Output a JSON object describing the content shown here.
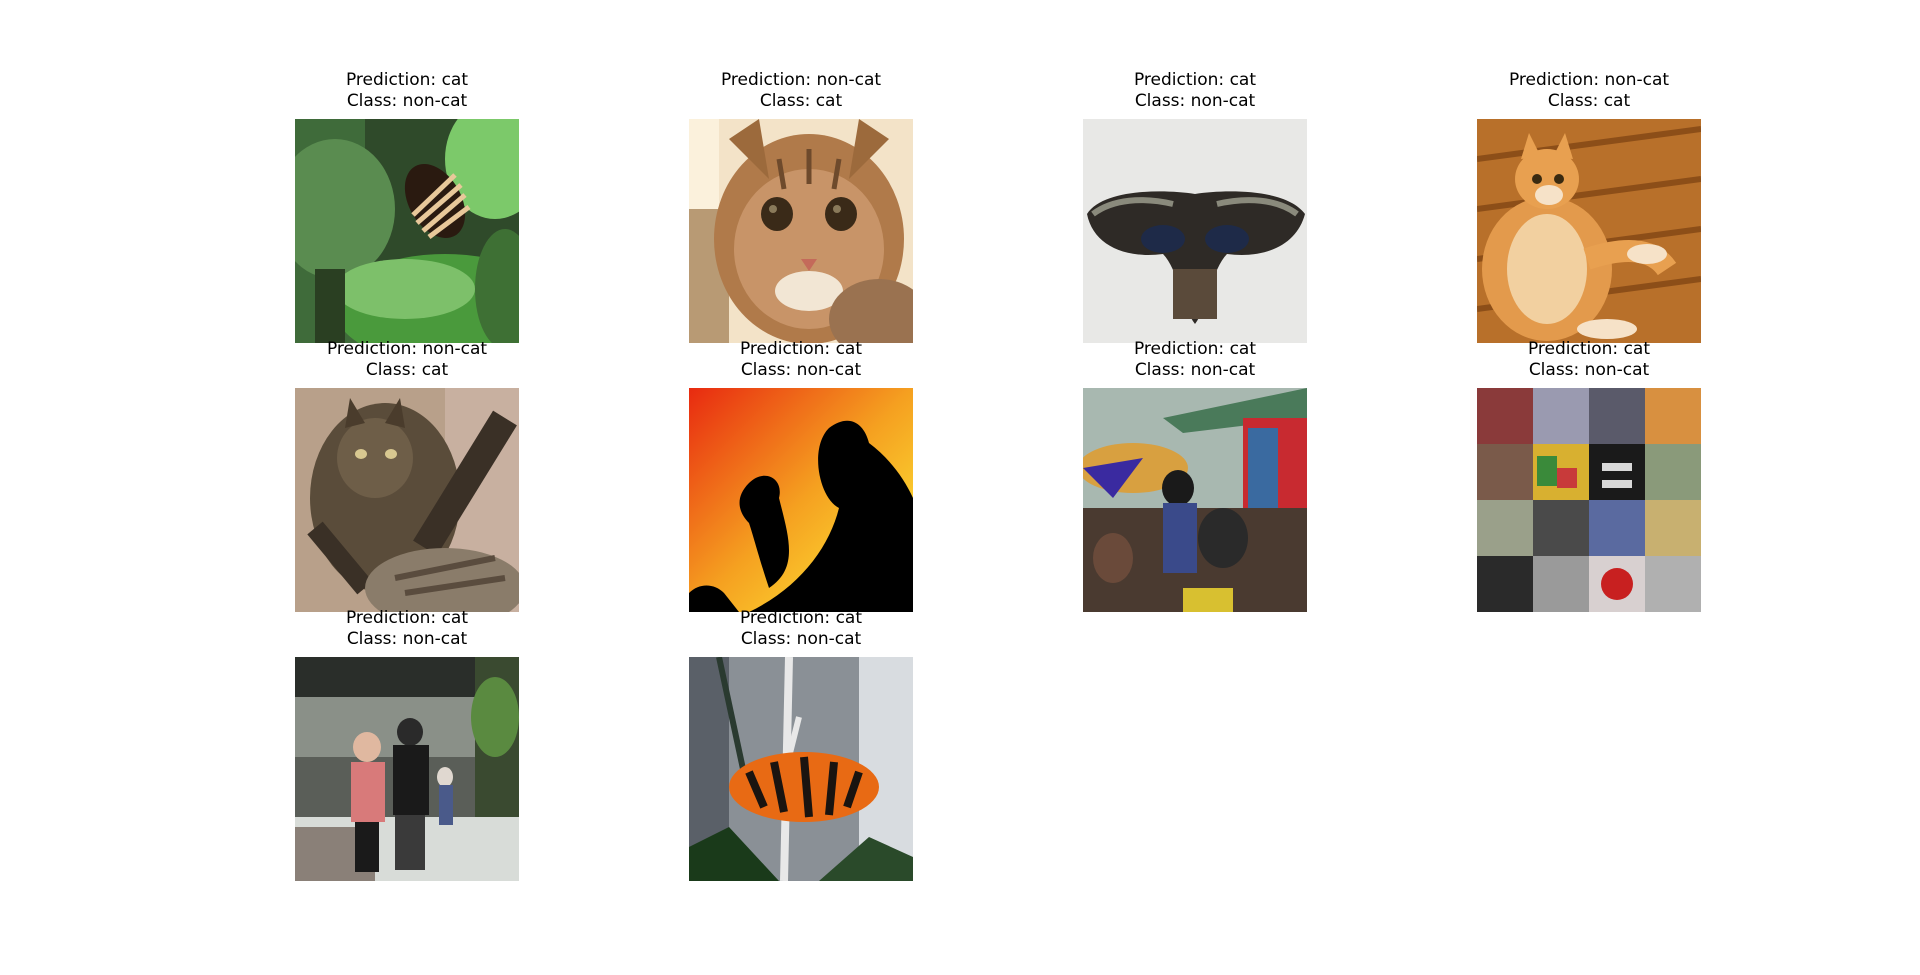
{
  "figure": {
    "panels": [
      {
        "prediction": "Prediction: cat",
        "class": "Class: non-cat",
        "image": "butterfly-on-leaves"
      },
      {
        "prediction": "Prediction: non-cat",
        "class": "Class: cat",
        "image": "tabby-cat-face"
      },
      {
        "prediction": "Prediction: cat",
        "class": "Class: non-cat",
        "image": "dark-butterfly"
      },
      {
        "prediction": "Prediction: non-cat",
        "class": "Class: cat",
        "image": "orange-cat-on-floor"
      },
      {
        "prediction": "Prediction: non-cat",
        "class": "Class: cat",
        "image": "fluffy-cat"
      },
      {
        "prediction": "Prediction: cat",
        "class": "Class: non-cat",
        "image": "bird-silhouettes-sunset"
      },
      {
        "prediction": "Prediction: cat",
        "class": "Class: non-cat",
        "image": "market-street-scene"
      },
      {
        "prediction": "Prediction: cat",
        "class": "Class: non-cat",
        "image": "photo-collage"
      },
      {
        "prediction": "Prediction: cat",
        "class": "Class: non-cat",
        "image": "people-photographing"
      },
      {
        "prediction": "Prediction: cat",
        "class": "Class: non-cat",
        "image": "orange-butterfly"
      }
    ]
  }
}
